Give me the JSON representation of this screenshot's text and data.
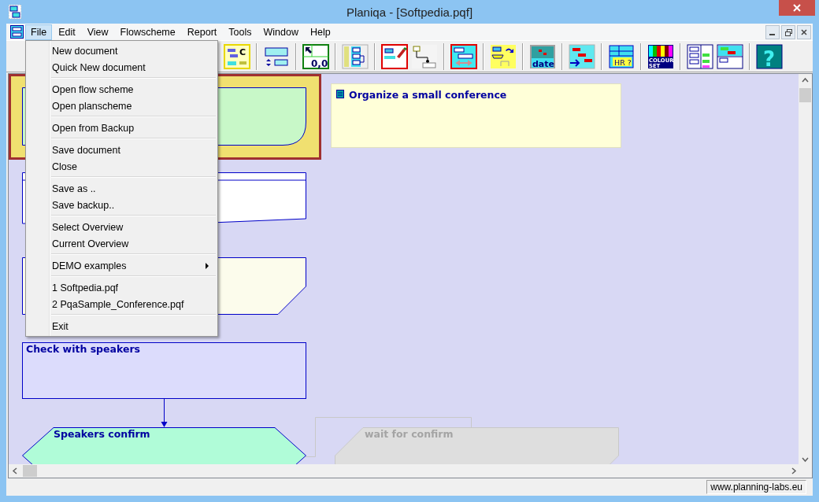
{
  "window": {
    "title": "Planiqa - [Softpedia.pqf]"
  },
  "menu_bar": [
    {
      "label": "File",
      "selected": true
    },
    {
      "label": "Edit",
      "selected": false
    },
    {
      "label": "View",
      "selected": false
    },
    {
      "label": "Flowscheme",
      "selected": false
    },
    {
      "label": "Report",
      "selected": false
    },
    {
      "label": "Tools",
      "selected": false
    },
    {
      "label": "Window",
      "selected": false
    },
    {
      "label": "Help",
      "selected": false
    }
  ],
  "toolbar": [
    {
      "kind": "sketch",
      "label": "C"
    },
    {
      "kind": "separator"
    },
    {
      "kind": "resize"
    },
    {
      "kind": "separator"
    },
    {
      "kind": "origin",
      "label": "0,0"
    },
    {
      "kind": "separator"
    },
    {
      "kind": "tree"
    },
    {
      "kind": "separator"
    },
    {
      "kind": "pen"
    },
    {
      "kind": "connector"
    },
    {
      "kind": "separator"
    },
    {
      "kind": "align"
    },
    {
      "kind": "separator"
    },
    {
      "kind": "flow"
    },
    {
      "kind": "separator"
    },
    {
      "kind": "date",
      "label": "date"
    },
    {
      "kind": "separator"
    },
    {
      "kind": "gantt"
    },
    {
      "kind": "separator"
    },
    {
      "kind": "hr",
      "label": "HR ?"
    },
    {
      "kind": "separator"
    },
    {
      "kind": "colour",
      "label": "COLOUR SET"
    },
    {
      "kind": "separator"
    },
    {
      "kind": "columns"
    },
    {
      "kind": "plan"
    },
    {
      "kind": "separator"
    },
    {
      "kind": "help",
      "label": "?"
    }
  ],
  "file_menu": [
    {
      "kind": "item",
      "label": "New document"
    },
    {
      "kind": "item",
      "label": "Quick New document"
    },
    {
      "kind": "separator"
    },
    {
      "kind": "item",
      "label": "Open flow scheme"
    },
    {
      "kind": "item",
      "label": "Open planscheme"
    },
    {
      "kind": "separator"
    },
    {
      "kind": "item",
      "label": "Open from Backup"
    },
    {
      "kind": "separator"
    },
    {
      "kind": "item",
      "label": "Save document"
    },
    {
      "kind": "item",
      "label": "Close"
    },
    {
      "kind": "separator"
    },
    {
      "kind": "item",
      "label": "Save as .."
    },
    {
      "kind": "item",
      "label": "Save backup.."
    },
    {
      "kind": "separator"
    },
    {
      "kind": "item",
      "label": "Select Overview"
    },
    {
      "kind": "item",
      "label": "Current Overview"
    },
    {
      "kind": "separator"
    },
    {
      "kind": "submenu",
      "label": "DEMO examples"
    },
    {
      "kind": "separator"
    },
    {
      "kind": "item",
      "label": "1 Softpedia.pqf"
    },
    {
      "kind": "item",
      "label": "2 PqaSample_Conference.pqf"
    },
    {
      "kind": "separator"
    },
    {
      "kind": "item",
      "label": "Exit"
    }
  ],
  "canvas": {
    "nodes": [
      {
        "kind": "terminal",
        "selected": true,
        "disabled": false
      },
      {
        "kind": "note",
        "label": "Organize a small conference",
        "selected": false,
        "disabled": false
      },
      {
        "kind": "table",
        "selected": false,
        "disabled": false
      },
      {
        "kind": "manual",
        "selected": false,
        "disabled": false
      },
      {
        "kind": "process",
        "label": "Check with speakers",
        "selected": false,
        "disabled": false
      },
      {
        "kind": "decision",
        "label": "Speakers confirm",
        "selected": false,
        "disabled": false
      },
      {
        "kind": "wait",
        "label": "wait for confirm",
        "selected": false,
        "disabled": true
      }
    ]
  },
  "status_bar": {
    "link": "www.planning-labs.eu"
  }
}
